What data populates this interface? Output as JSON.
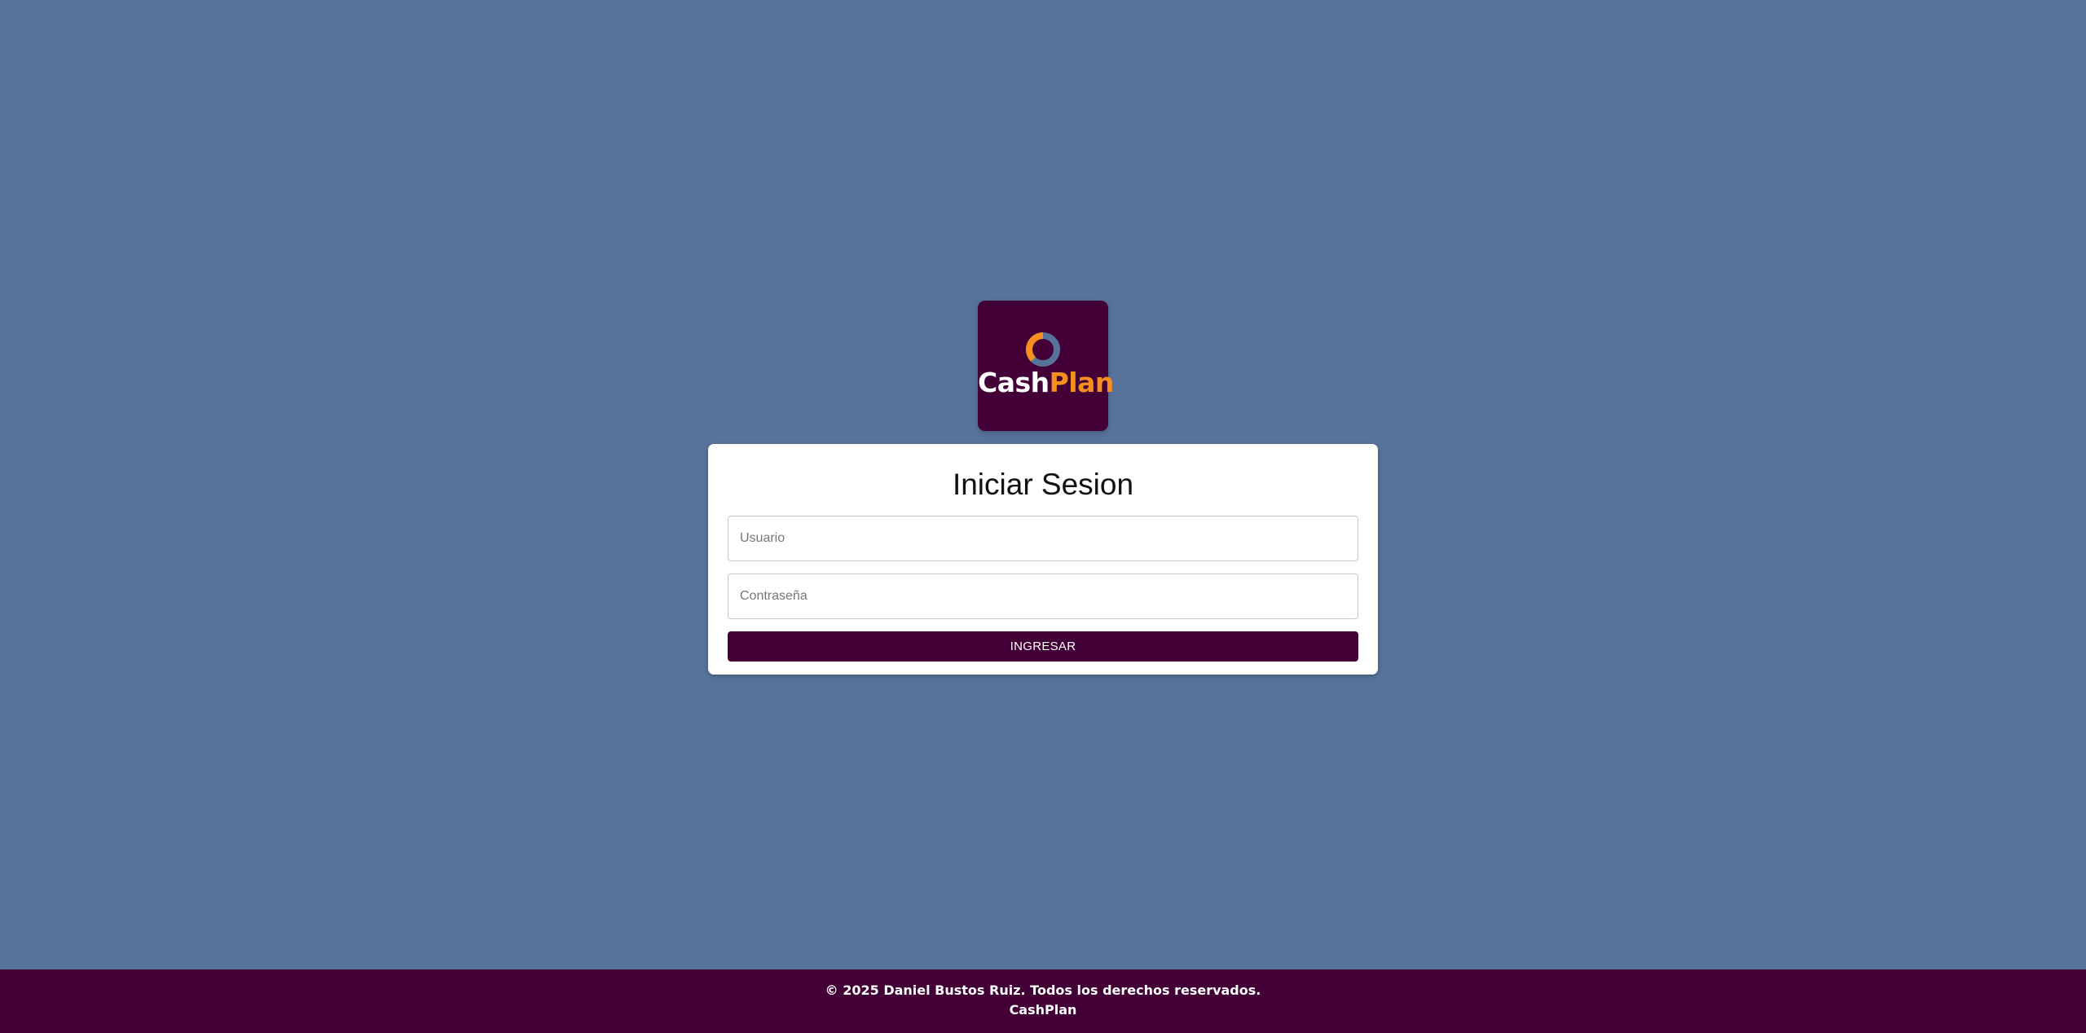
{
  "logo": {
    "word_part1": "Cash",
    "word_part2": "Plan",
    "background_color": "#420036",
    "accent_color": "#f5901e",
    "ring_icon": "ring-logo-icon"
  },
  "login": {
    "title": "Iniciar Sesion",
    "username_placeholder": "Usuario",
    "username_value": "",
    "password_placeholder": "Contraseña",
    "password_value": "",
    "submit_label": "INGRESAR"
  },
  "footer": {
    "copyright": "© 2025 Daniel Bustos Ruiz. Todos los derechos reservados.",
    "brand": "CashPlan"
  },
  "colors": {
    "page_background": "#58739b",
    "primary": "#420036",
    "card": "#ffffff"
  }
}
